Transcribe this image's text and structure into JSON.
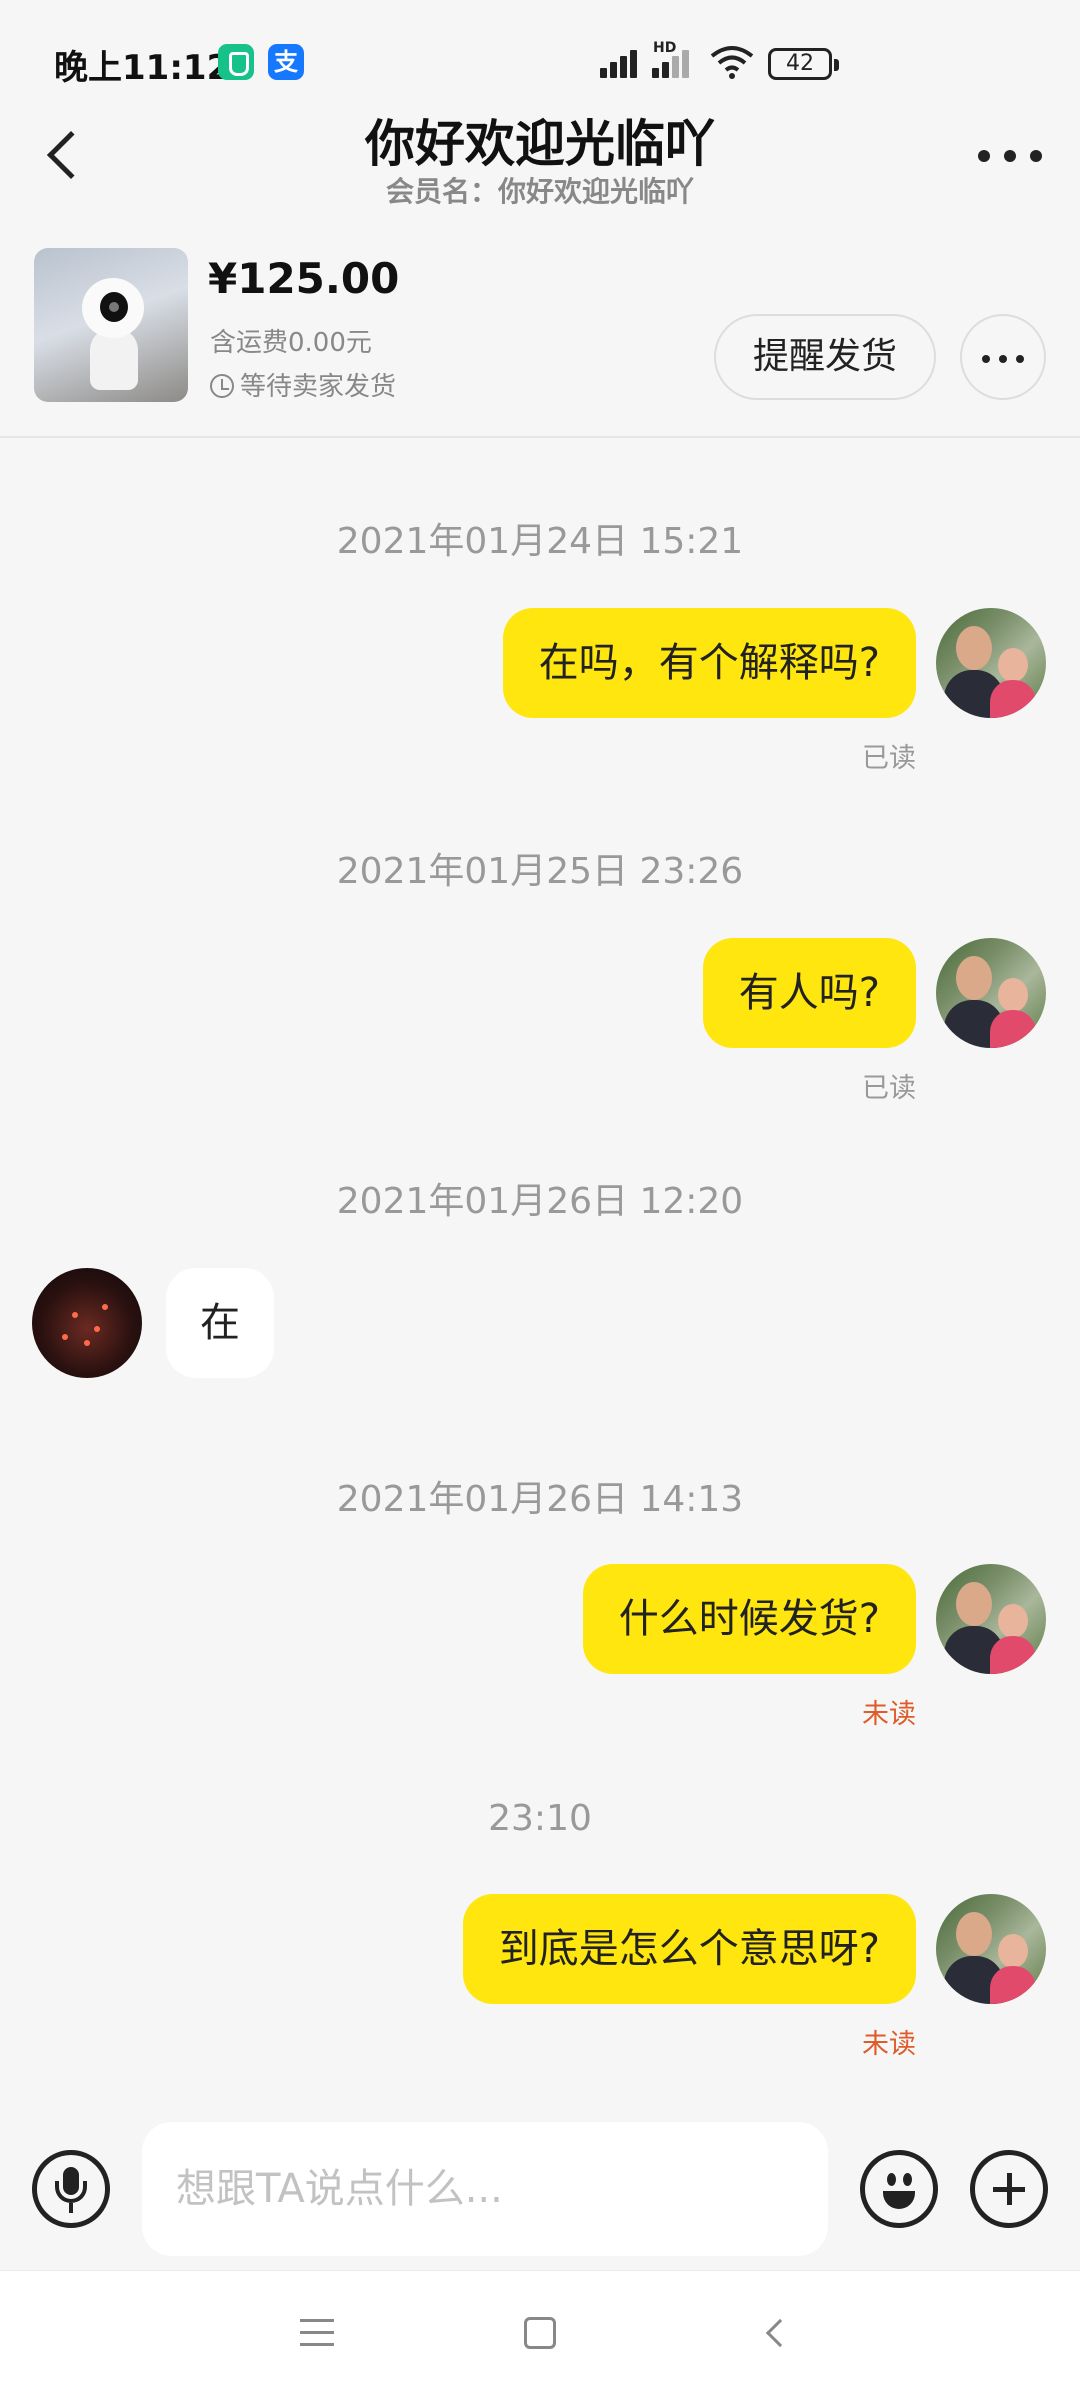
{
  "status_bar": {
    "time": "晚上11:12",
    "hd_label": "HD",
    "battery": "42"
  },
  "header": {
    "title": "你好欢迎光临吖",
    "member_label": "会员名：你好欢迎光临吖"
  },
  "order": {
    "price": "¥125.00",
    "shipping": "含运费0.00元",
    "status": "等待卖家发货",
    "remind_button": "提醒发货"
  },
  "messages": [
    {
      "timestamp": "2021年01月24日 15:21",
      "from": "me",
      "text": "在吗，有个解释吗?",
      "read_status": "已读"
    },
    {
      "timestamp": "2021年01月25日 23:26",
      "from": "me",
      "text": "有人吗?",
      "read_status": "已读"
    },
    {
      "timestamp": "2021年01月26日 12:20",
      "from": "other",
      "text": "在"
    },
    {
      "timestamp": "2021年01月26日 14:13",
      "from": "me",
      "text": "什么时候发货?",
      "read_status": "未读"
    },
    {
      "timestamp": "23:10",
      "from": "me",
      "text": "到底是怎么个意思呀?",
      "read_status": "未读"
    }
  ],
  "input": {
    "placeholder": "想跟TA说点什么..."
  },
  "icons": {
    "back": "back-arrow-icon",
    "more": "more-dots-icon",
    "clock": "clock-icon",
    "mic": "microphone-icon",
    "emoji": "emoji-icon",
    "plus": "plus-icon"
  },
  "colors": {
    "bubble_out": "#ffe60f",
    "unread": "#e05b2a",
    "background": "#f6f6f6"
  }
}
